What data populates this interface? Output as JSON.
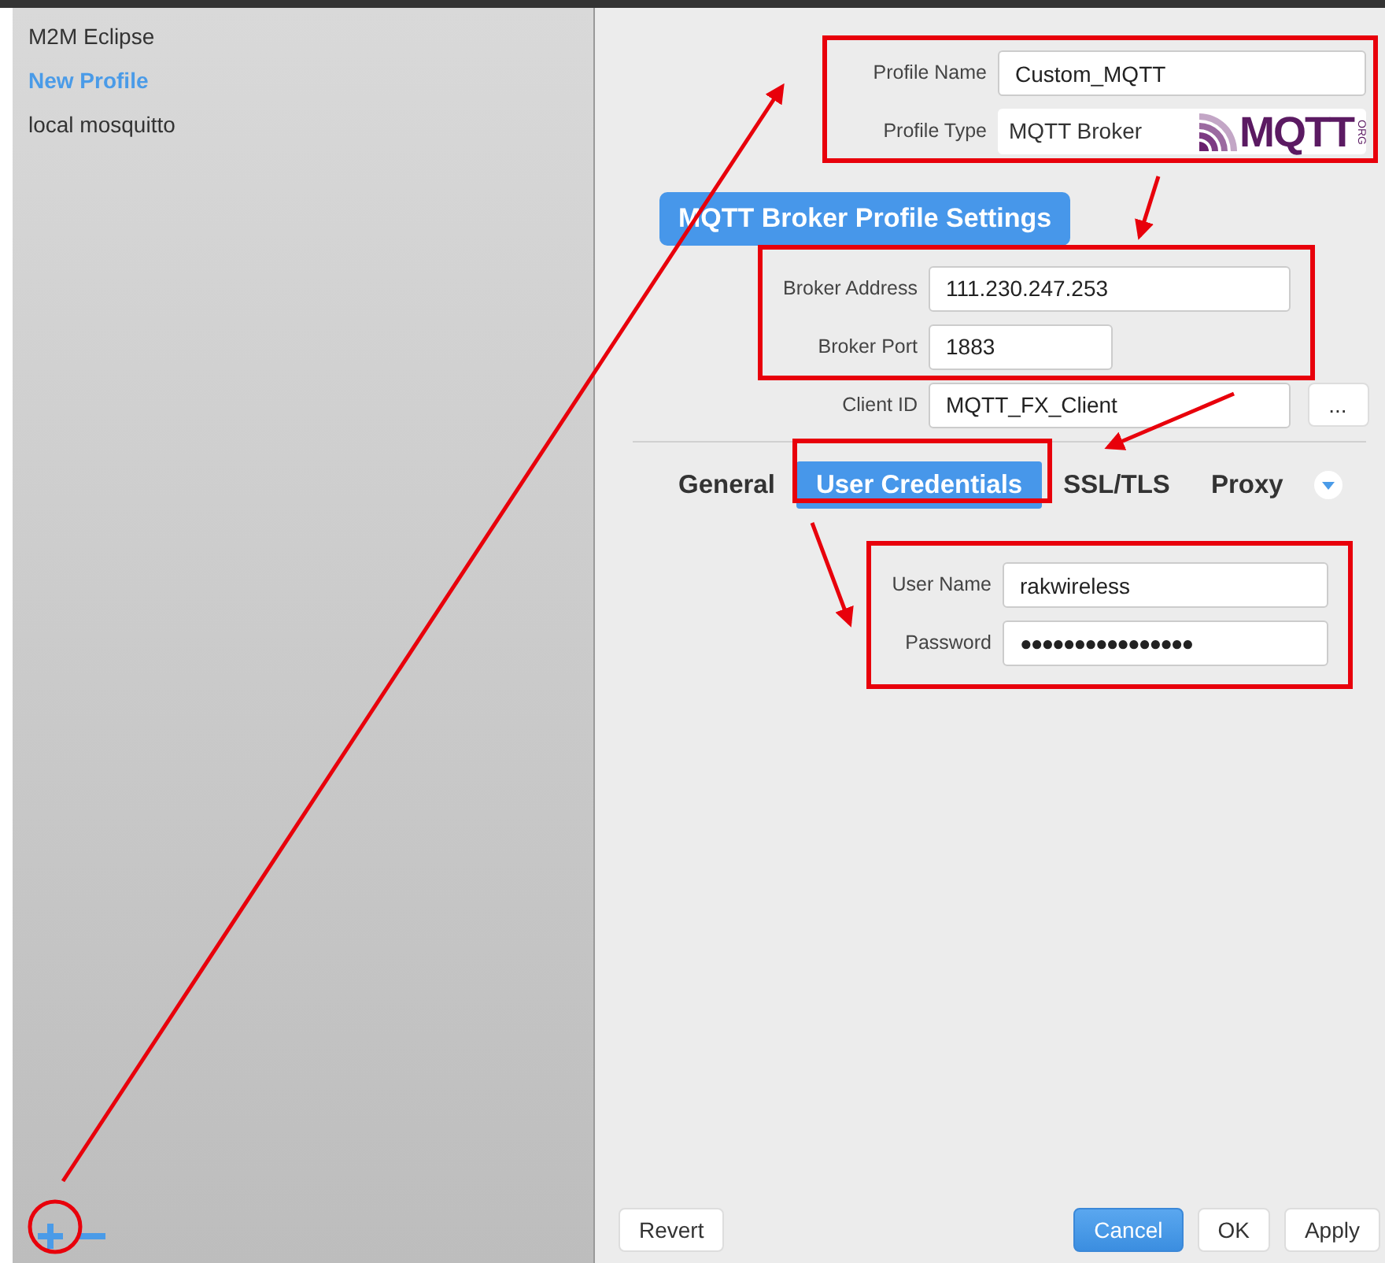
{
  "sidebar": {
    "items": [
      {
        "label": "M2M Eclipse",
        "selected": false
      },
      {
        "label": "New Profile",
        "selected": true
      },
      {
        "label": "local mosquitto",
        "selected": false
      }
    ]
  },
  "profile": {
    "name": {
      "label": "Profile Name",
      "value": "Custom_MQTT"
    },
    "type": {
      "label": "Profile Type",
      "value": "MQTT Broker"
    },
    "logo": {
      "text": "MQTT",
      "sub": "ORG"
    }
  },
  "section_title": "MQTT Broker Profile Settings",
  "broker": {
    "address": {
      "label": "Broker Address",
      "value": "111.230.247.253"
    },
    "port": {
      "label": "Broker Port",
      "value": "1883"
    },
    "client_id": {
      "label": "Client ID",
      "value": "MQTT_FX_Client"
    },
    "generate_button": "..."
  },
  "tabs": [
    {
      "label": "General",
      "selected": false
    },
    {
      "label": "User Credentials",
      "selected": true
    },
    {
      "label": "SSL/TLS",
      "selected": false
    },
    {
      "label": "Proxy",
      "selected": false
    }
  ],
  "credentials": {
    "user_name": {
      "label": "User Name",
      "value": "rakwireless"
    },
    "password": {
      "label": "Password",
      "value": "●●●●●●●●●●●●●●●●"
    }
  },
  "buttons": [
    {
      "label": "Revert",
      "default": false
    },
    {
      "label": "Cancel",
      "default": true
    },
    {
      "label": "OK",
      "default": false
    },
    {
      "label": "Apply",
      "default": false
    }
  ],
  "annotations": [
    {
      "kind": "box"
    },
    {
      "kind": "box"
    },
    {
      "kind": "box"
    },
    {
      "kind": "box"
    },
    {
      "kind": "circle"
    },
    {
      "kind": "arrow"
    },
    {
      "kind": "arrow"
    },
    {
      "kind": "arrow"
    },
    {
      "kind": "arrow"
    }
  ]
}
